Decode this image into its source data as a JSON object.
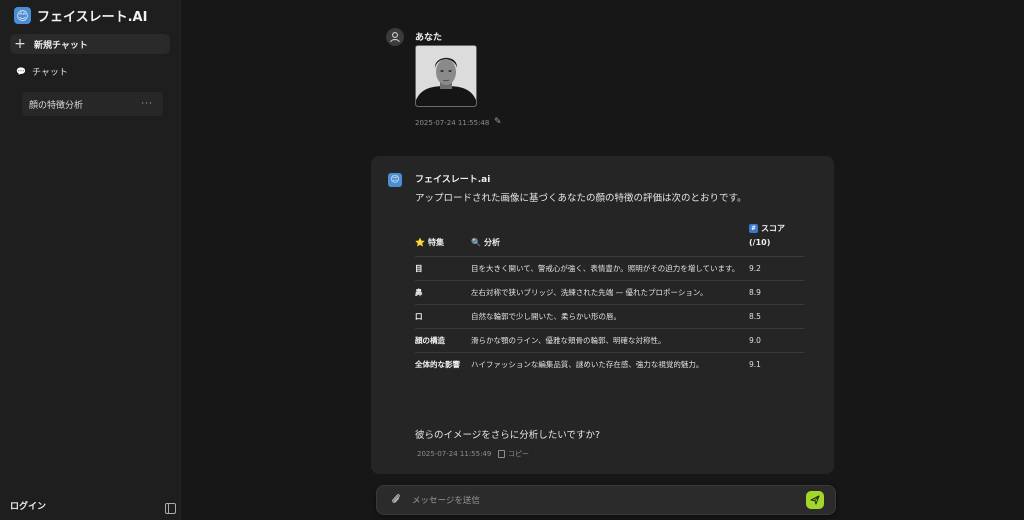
{
  "sidebar": {
    "brand": "フェイスレート.AI",
    "new_chat": "新規チャット",
    "chat_section": "チャット",
    "history": [
      {
        "label": "顔の特徴分析"
      }
    ],
    "more": "···",
    "login": "ログイン"
  },
  "user_message": {
    "name": "あなた",
    "timestamp": "2025-07-24 11:55:48"
  },
  "bot_message": {
    "name": "フェイスレート.ai",
    "intro": "アップロードされた画像に基づくあなたの顔の特徴の評価は次のとおりです。",
    "table": {
      "headers": [
        "特集",
        "分析",
        "スコア (/10)"
      ],
      "rows": [
        {
          "feature": "目",
          "analysis": "目を大きく開いて、警戒心が強く、表情豊か。照明がその迫力を増しています。",
          "score": "9.2"
        },
        {
          "feature": "鼻",
          "analysis": "左右対称で狭いブリッジ、洗練された先端 — 優れたプロポーション。",
          "score": "8.9"
        },
        {
          "feature": "口",
          "analysis": "自然な輪郭で少し開いた、柔らかい形の唇。",
          "score": "8.5"
        },
        {
          "feature": "顔の構造",
          "analysis": "滑らかな顎のライン、優雅な頬骨の輪郭、明確な対称性。",
          "score": "9.0"
        },
        {
          "feature": "全体的な影響",
          "analysis": "ハイファッションな編集品質、謎めいた存在感、強力な視覚的魅力。",
          "score": "9.1"
        }
      ]
    },
    "followup": "彼らのイメージをさらに分析したいですか?",
    "timestamp": "2025-07-24 11:55:49",
    "copy_label": "コピー"
  },
  "composer": {
    "placeholder": "メッセージを送信"
  },
  "colors": {
    "background": "#171717",
    "sidebar": "#1e1e1e",
    "card": "#252525",
    "send_button": "#a3d62a",
    "brand_logo": "#4a8fd6"
  }
}
